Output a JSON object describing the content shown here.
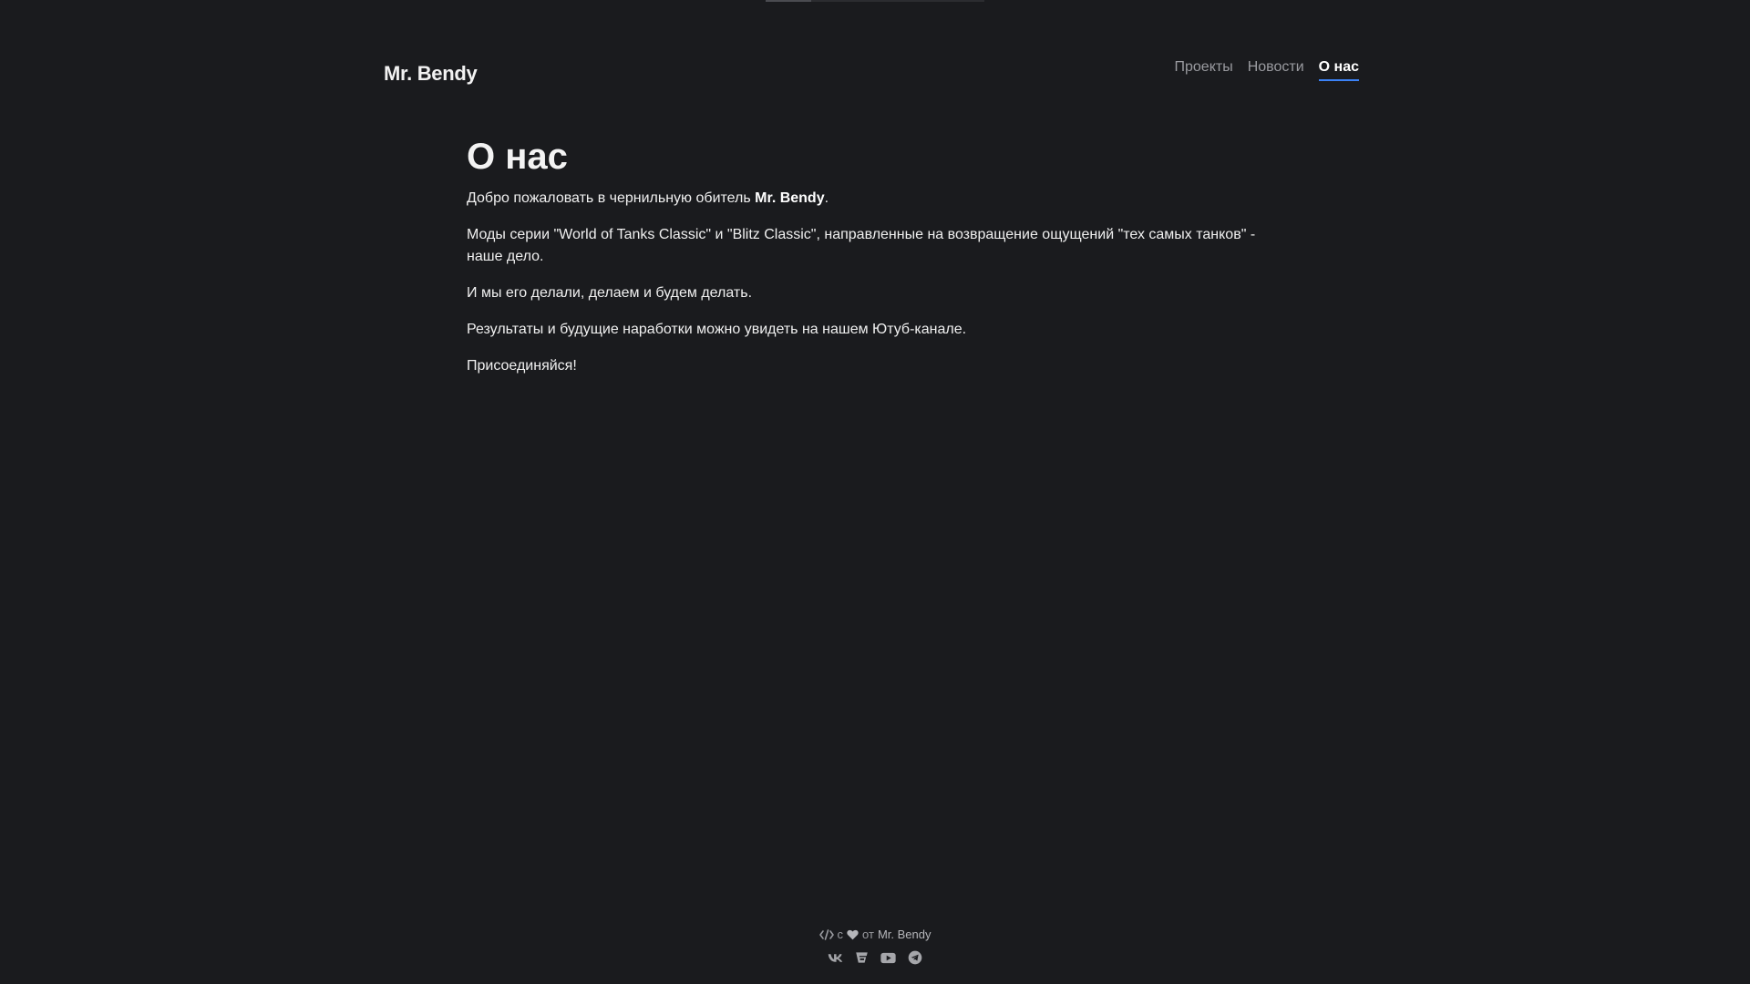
{
  "site": {
    "logo": "Mr. Bendy"
  },
  "nav": {
    "items": [
      {
        "label": "Проекты"
      },
      {
        "label": "Новости"
      },
      {
        "label": "О нас"
      }
    ]
  },
  "main": {
    "title": "О нас",
    "p1_before": "Добро пожаловать в чернильную обитель ",
    "p1_strong": "Mr. Bendy",
    "p1_after": ".",
    "p2": "Моды серии \"World of Tanks Classic\" и \"Blitz Classic\", направленные на возвращение ощущений \"тех самых танков\" - наше дело.",
    "p3": "И мы его делали, делаем и будем делать.",
    "p4": "Результаты и будущие наработки можно увидеть на нашем Ютуб-канале.",
    "p5": "Присоединяйся!"
  },
  "footer": {
    "with": "с",
    "from": "от",
    "author": "Mr. Bendy",
    "icons": [
      "code-icon",
      "heart-icon",
      "vk-icon",
      "boosty-icon",
      "youtube-icon",
      "telegram-icon"
    ]
  },
  "colors": {
    "background": "#1a1b1e",
    "accent": "#3b82f6",
    "muted": "#9a9ba0"
  }
}
